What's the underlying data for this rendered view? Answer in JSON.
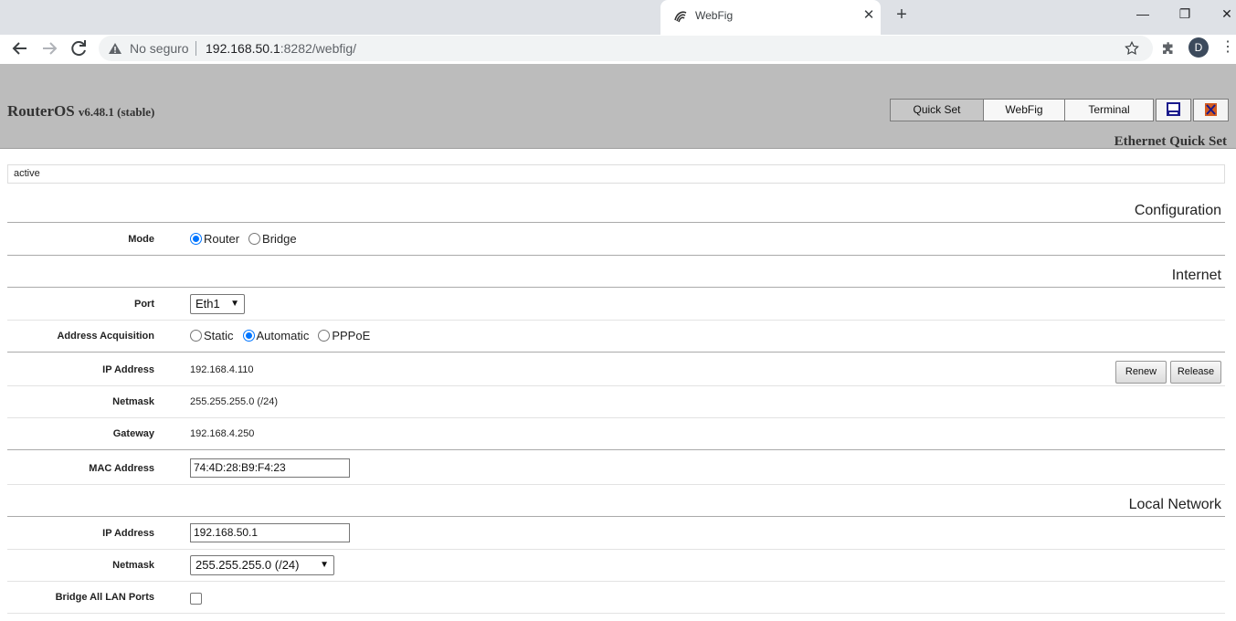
{
  "browser": {
    "tab_title": "WebFig",
    "tab_close_glyph": "✕",
    "new_tab_glyph": "+",
    "window_controls": [
      "—",
      "❐",
      "✕"
    ],
    "security_label": "No seguro",
    "url_host": "192.168.50.1",
    "url_rest": ":8282/webfig/",
    "profile_initial": "D"
  },
  "header": {
    "product": "RouterOS",
    "version": "v6.48.1 (stable)",
    "modes": [
      "Quick Set",
      "WebFig",
      "Terminal"
    ],
    "active_mode": "Quick Set",
    "page_name": "Ethernet Quick Set"
  },
  "status": {
    "text": "active"
  },
  "sections": {
    "configuration": "Configuration",
    "internet": "Internet",
    "local_network": "Local Network"
  },
  "config": {
    "mode_label": "Mode",
    "mode_options": [
      "Router",
      "Bridge"
    ],
    "mode_selected": "Router"
  },
  "internet": {
    "port_label": "Port",
    "port_value": "Eth1",
    "acq_label": "Address Acquisition",
    "acq_options": [
      "Static",
      "Automatic",
      "PPPoE"
    ],
    "acq_selected": "Automatic",
    "ip_label": "IP Address",
    "ip_value": "192.168.4.110",
    "renew_label": "Renew",
    "release_label": "Release",
    "netmask_label": "Netmask",
    "netmask_value": "255.255.255.0 (/24)",
    "gateway_label": "Gateway",
    "gateway_value": "192.168.4.250",
    "mac_label": "MAC Address",
    "mac_value": "74:4D:28:B9:F4:23"
  },
  "lan": {
    "ip_label": "IP Address",
    "ip_value": "192.168.50.1",
    "netmask_label": "Netmask",
    "netmask_value": "255.255.255.0 (/24)",
    "bridge_label": "Bridge All LAN Ports",
    "bridge_checked": false
  },
  "colors": {
    "accent": "#0075ff",
    "header_bg": "#bcbcbc"
  }
}
